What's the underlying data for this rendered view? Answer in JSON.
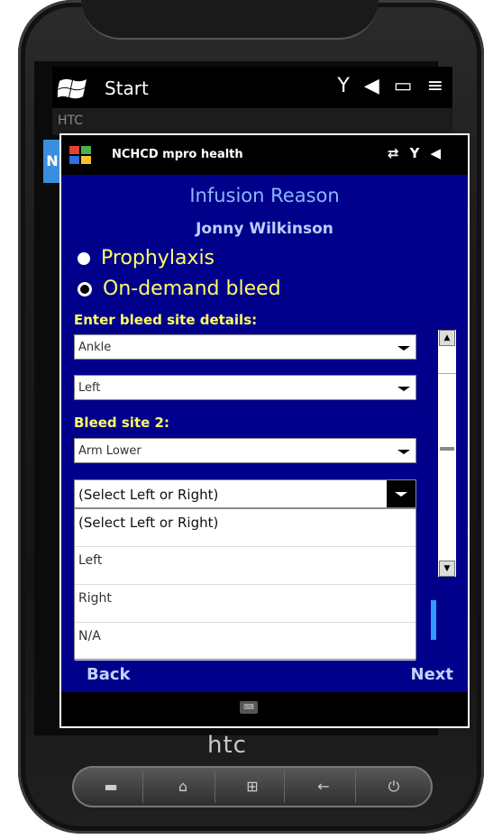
{
  "device": {
    "brand_logo": "htc"
  },
  "os_bar": {
    "start_label": "Start",
    "carrier_label": "HTC",
    "icons": [
      "signal-icon",
      "speaker-icon",
      "battery-icon",
      "menu-icon"
    ]
  },
  "app": {
    "title": "NCHCD mpro health",
    "side_tab": "N",
    "heading": "Infusion Reason",
    "patient_name": "Jonny Wilkinson",
    "radio_options": [
      {
        "label": "Prophylaxis",
        "selected": true
      },
      {
        "label": "On-demand bleed",
        "selected": false
      }
    ],
    "bleed_site_label": "Enter bleed site details:",
    "bleed_site_1": {
      "location": "Ankle",
      "side": "Left"
    },
    "bleed_site_2_label": "Bleed site 2:",
    "bleed_site_2": {
      "location": "Arm Lower",
      "side_selected": "(Select Left or Right)"
    },
    "side_options": [
      "(Select Left or Right)",
      "Left",
      "Right",
      "N/A"
    ],
    "back_label": "Back",
    "next_label": "Next"
  },
  "colors": {
    "app_background": "#00008b",
    "label_yellow": "#ffff66",
    "heading_blue": "#8cb6ff"
  }
}
